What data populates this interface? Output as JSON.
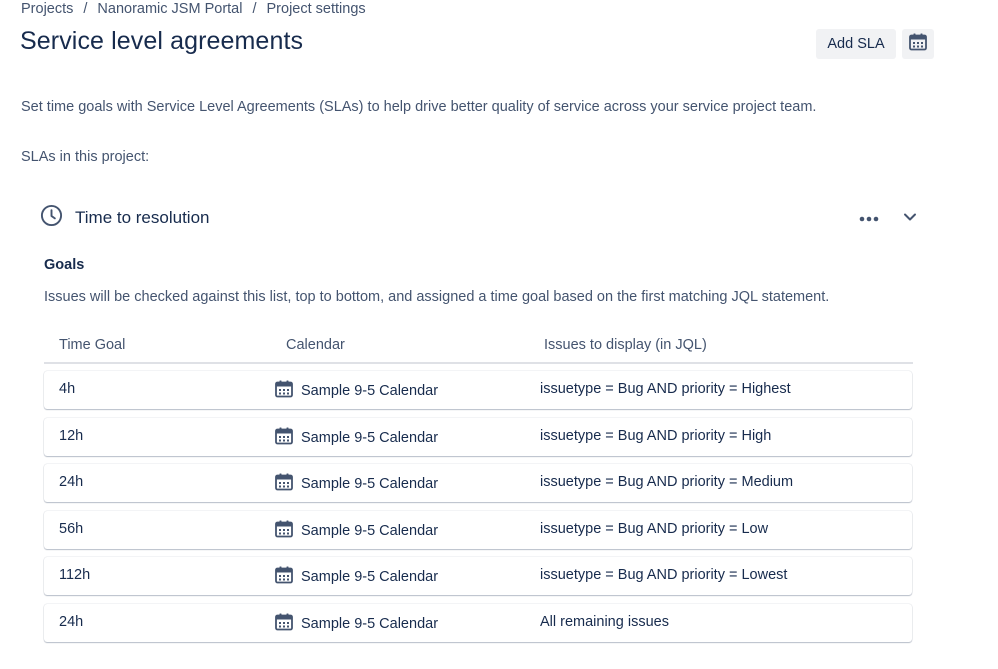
{
  "breadcrumb": [
    "Projects",
    "Nanoramic JSM Portal",
    "Project settings"
  ],
  "page_title": "Service level agreements",
  "actions": {
    "add_sla": "Add SLA",
    "calendar_icon": "calendar-icon"
  },
  "intro": "Set time goals with Service Level Agreements (SLAs) to help drive better quality of service across your service project team.",
  "slas_label": "SLAs in this project:",
  "sla": {
    "name": "Time to resolution",
    "icon": "clock-icon",
    "goals_heading": "Goals",
    "goals_desc": "Issues will be checked against this list, top to bottom, and assigned a time goal based on the first matching JQL statement.",
    "columns": [
      "Time Goal",
      "Calendar",
      "Issues to display (in JQL)"
    ],
    "rows": [
      {
        "goal": "4h",
        "calendar": "Sample 9-5 Calendar",
        "jql": "issuetype = Bug AND priority = Highest"
      },
      {
        "goal": "12h",
        "calendar": "Sample 9-5 Calendar",
        "jql": "issuetype = Bug AND priority = High"
      },
      {
        "goal": "24h",
        "calendar": "Sample 9-5 Calendar",
        "jql": "issuetype = Bug AND priority = Medium"
      },
      {
        "goal": "56h",
        "calendar": "Sample 9-5 Calendar",
        "jql": "issuetype = Bug AND priority = Low"
      },
      {
        "goal": "112h",
        "calendar": "Sample 9-5 Calendar",
        "jql": "issuetype = Bug AND priority = Lowest"
      },
      {
        "goal": "24h",
        "calendar": "Sample 9-5 Calendar",
        "jql": "All remaining issues"
      }
    ]
  },
  "colors": {
    "text": "#172b4d",
    "subtle": "#44546f",
    "button_bg": "#f1f2f4",
    "divider": "#dfe1e6"
  }
}
